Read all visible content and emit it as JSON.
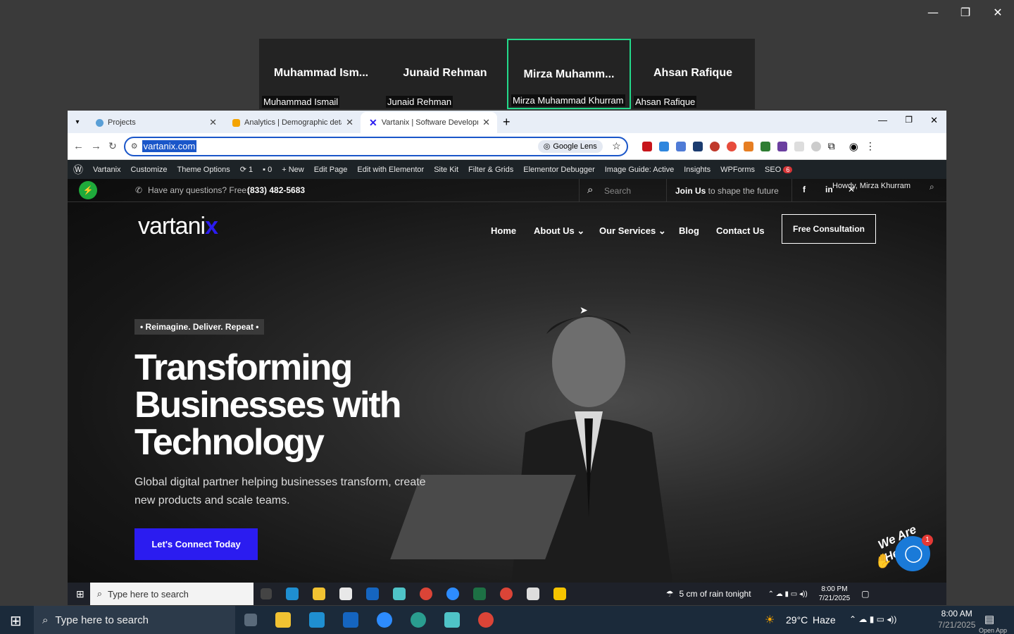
{
  "zoom": {
    "participants": [
      {
        "display": "Muhammad  Ism...",
        "name": "Muhammad Ismail",
        "active": false
      },
      {
        "display": "Junaid Rehman",
        "name": "Junaid Rehman",
        "active": false
      },
      {
        "display": "Mirza  Muhamm...",
        "name": "Mirza Muhammad Khurram",
        "active": true
      },
      {
        "display": "Ahsan Rafique",
        "name": "Ahsan Rafique",
        "active": false
      }
    ]
  },
  "browser": {
    "tabs": [
      {
        "label": "Projects",
        "active": false
      },
      {
        "label": "Analytics | Demographic details",
        "active": false
      },
      {
        "label": "Vartanix | Software Development",
        "active": true
      }
    ],
    "url": "vartanix.com",
    "lens_label": "Google Lens"
  },
  "wpbar": {
    "site_name": "Vartanix",
    "customize": "Customize",
    "theme_options": "Theme Options",
    "updates": "1",
    "comments": "0",
    "new": "New",
    "edit_page": "Edit Page",
    "edit_elementor": "Edit with Elementor",
    "site_kit": "Site Kit",
    "filter_grids": "Filter & Grids",
    "elementor_debugger": "Elementor Debugger",
    "image_guide": "Image Guide: Active",
    "insights": "Insights",
    "wpforms": "WPForms",
    "seo": "SEO",
    "seo_badge": "6",
    "howdy": "Howdy, Mirza Khurram"
  },
  "site": {
    "questions": "Have any questions? Free:",
    "phone": "(833) 482-5683",
    "search_placeholder": "Search",
    "join_bold": "Join Us",
    "join_rest": " to shape the future",
    "logo_text": "vartani",
    "logo_x": "x",
    "nav": [
      "Home",
      "About Us",
      "Our Services",
      "Blog",
      "Contact Us"
    ],
    "consult": "Free Consultation",
    "pill": "• Reimagine. Deliver. Repeat •",
    "hero_line1": "Transforming",
    "hero_line2": "Businesses with",
    "hero_line3": "Technology",
    "hero_sub": "Global digital partner helping businesses transform, create new products and scale teams.",
    "cta": "Let's Connect Today",
    "chat_badge": "1",
    "chat_banner": "We Are Here!"
  },
  "inner_taskbar": {
    "search": "Type here to search",
    "weather": "5 cm of rain tonight",
    "time": "8:00 PM",
    "date": "7/21/2025"
  },
  "outer_taskbar": {
    "search": "Type here to search",
    "temp": "29°C",
    "cond": "Haze",
    "time": "8:00 AM",
    "date": "7/21/2025",
    "corner": "Open App"
  },
  "colors": {
    "accent": "#2b1cf0",
    "active_tile": "#23d98a",
    "wp_bar": "#1d2327"
  }
}
